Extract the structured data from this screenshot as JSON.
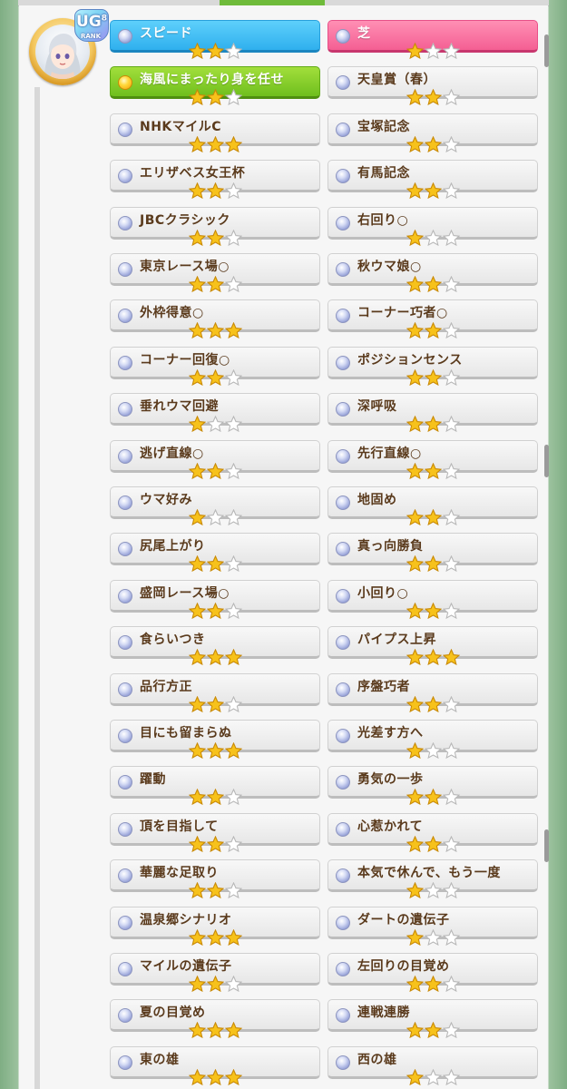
{
  "profile": {
    "rank_letters": "UG",
    "rank_sub": "8",
    "rank_caption": "RANK"
  },
  "colors": {
    "speed": "#2fb0ee",
    "turf": "#f45f93",
    "unique": "#6fbf1e",
    "label_brown": "#5a3a1c",
    "star_gold": "#f7c21b",
    "star_empty": "#ffffff"
  },
  "left_column": [
    {
      "label": "スピード",
      "stars": 2,
      "style": "speed"
    },
    {
      "label": "海風にまったり身を任せ",
      "stars": 2,
      "style": "unique"
    },
    {
      "label": "NHKマイルC",
      "stars": 3
    },
    {
      "label": "エリザベス女王杯",
      "stars": 2
    },
    {
      "label": "JBCクラシック",
      "stars": 2
    },
    {
      "label": "東京レース場○",
      "stars": 2
    },
    {
      "label": "外枠得意○",
      "stars": 3
    },
    {
      "label": "コーナー回復○",
      "stars": 2
    },
    {
      "label": "垂れウマ回避",
      "stars": 1
    },
    {
      "label": "逃げ直線○",
      "stars": 2
    },
    {
      "label": "ウマ好み",
      "stars": 1
    },
    {
      "label": "尻尾上がり",
      "stars": 2
    },
    {
      "label": "盛岡レース場○",
      "stars": 2
    },
    {
      "label": "食らいつき",
      "stars": 3
    },
    {
      "label": "品行方正",
      "stars": 2
    },
    {
      "label": "目にも留まらぬ",
      "stars": 3
    },
    {
      "label": "躍動",
      "stars": 2
    },
    {
      "label": "頂を目指して",
      "stars": 2
    },
    {
      "label": "華麗な足取り",
      "stars": 2
    },
    {
      "label": "温泉郷シナリオ",
      "stars": 3
    },
    {
      "label": "マイルの遺伝子",
      "stars": 2
    },
    {
      "label": "夏の目覚め",
      "stars": 3
    },
    {
      "label": "東の雄",
      "stars": 3
    }
  ],
  "right_column": [
    {
      "label": "芝",
      "stars": 1,
      "style": "turf"
    },
    {
      "label": "天皇賞（春）",
      "stars": 2
    },
    {
      "label": "宝塚記念",
      "stars": 2
    },
    {
      "label": "有馬記念",
      "stars": 2
    },
    {
      "label": "右回り○",
      "stars": 1
    },
    {
      "label": "秋ウマ娘○",
      "stars": 2
    },
    {
      "label": "コーナー巧者○",
      "stars": 2
    },
    {
      "label": "ポジションセンス",
      "stars": 2
    },
    {
      "label": "深呼吸",
      "stars": 2
    },
    {
      "label": "先行直線○",
      "stars": 2
    },
    {
      "label": "地固め",
      "stars": 2
    },
    {
      "label": "真っ向勝負",
      "stars": 2
    },
    {
      "label": "小回り○",
      "stars": 2
    },
    {
      "label": "パイプス上昇",
      "stars": 3
    },
    {
      "label": "序盤巧者",
      "stars": 2
    },
    {
      "label": "光差す方へ",
      "stars": 1
    },
    {
      "label": "勇気の一歩",
      "stars": 2
    },
    {
      "label": "心惹かれて",
      "stars": 2
    },
    {
      "label": "本気で休んで、もう一度",
      "stars": 1
    },
    {
      "label": "ダートの遺伝子",
      "stars": 1
    },
    {
      "label": "左回りの目覚め",
      "stars": 2
    },
    {
      "label": "連戦連勝",
      "stars": 2
    },
    {
      "label": "西の雄",
      "stars": 1
    }
  ]
}
